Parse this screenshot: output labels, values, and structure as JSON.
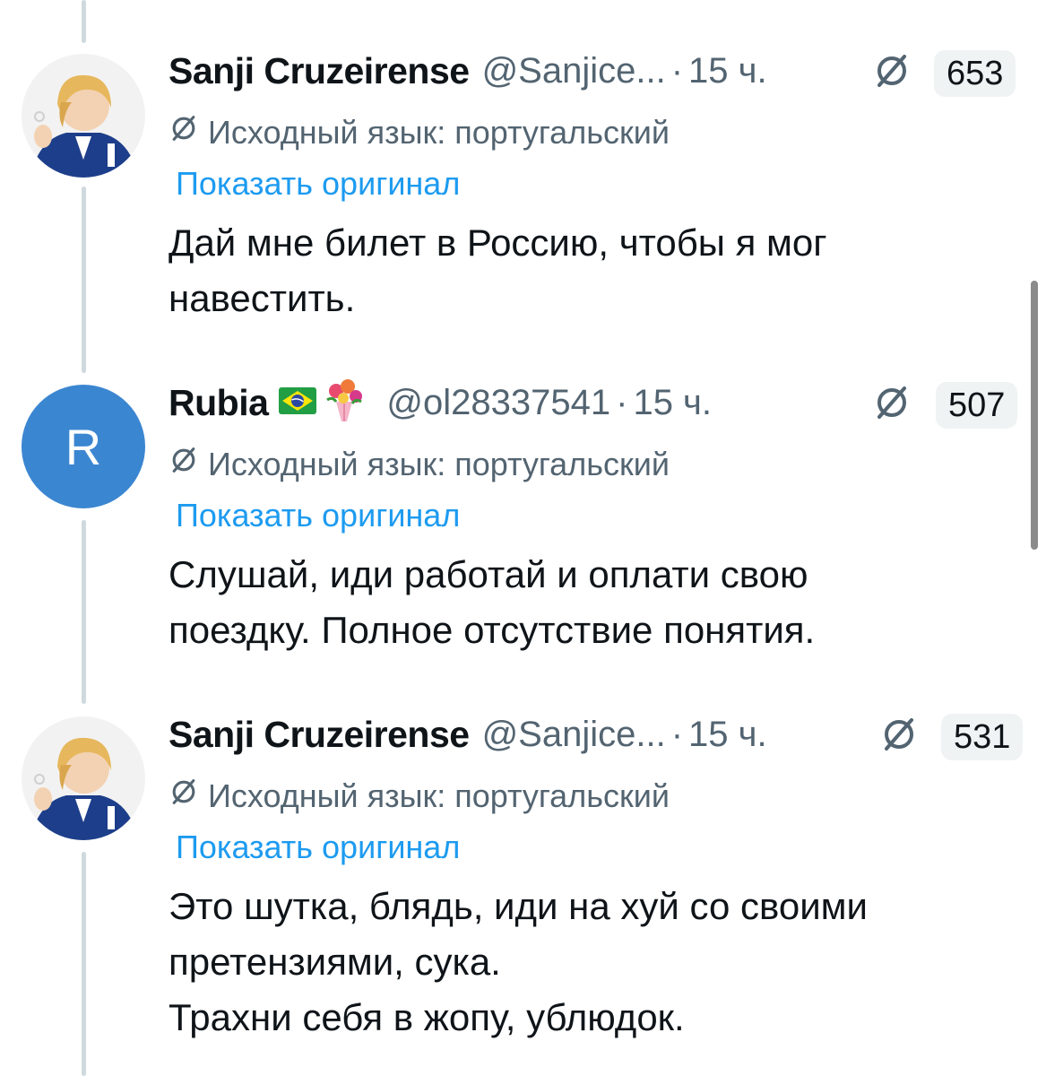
{
  "tweets": [
    {
      "name": "Sanji Cruzeirense",
      "handle": "@Sanjice...",
      "dot": "·",
      "time": "15 ч.",
      "count": "653",
      "lang_label": "Исходный язык: португальский",
      "show_original": "Показать оригинал",
      "lines": [
        "Дай мне билет в Россию, чтобы я мог",
        "навестить."
      ]
    },
    {
      "name": "Rubia",
      "flag_icons": [
        "brazil-flag-icon",
        "bouquet-icon"
      ],
      "handle": "@ol28337541",
      "dot": "·",
      "time": "15 ч.",
      "count": "507",
      "avatar_letter": "R",
      "lang_label": "Исходный язык: португальский",
      "show_original": "Показать оригинал",
      "lines": [
        "Слушай, иди работай и оплати свою",
        "поездку. Полное отсутствие понятия."
      ]
    },
    {
      "name": "Sanji Cruzeirense",
      "handle": "@Sanjice...",
      "dot": "·",
      "time": "15 ч.",
      "count": "531",
      "lang_label": "Исходный язык: португальский",
      "show_original": "Показать оригинал",
      "lines": [
        "Это шутка, блядь, иди на хуй со своими",
        "претензиями, сука.",
        "Трахни себя в жопу, ублюдок."
      ]
    }
  ],
  "colors": {
    "link": "#1d9bf0",
    "secondary_text": "#536471",
    "primary_text": "#0f1419",
    "avatar_letter_bg": "#3b86d1",
    "badge_bg": "#eff3f4",
    "thread_line": "#cfd9de"
  },
  "icons": {
    "grok": "grok-icon",
    "translate": "grok-small-icon"
  }
}
